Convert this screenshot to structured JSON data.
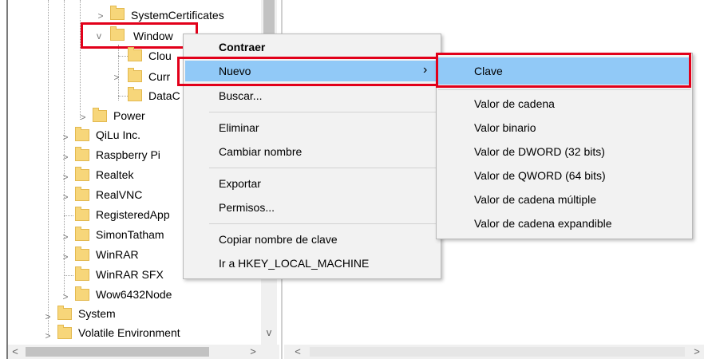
{
  "tree": {
    "items": [
      {
        "label": "SystemCertificates"
      },
      {
        "label": "Window"
      },
      {
        "label": "Clou"
      },
      {
        "label": "Curr"
      },
      {
        "label": "DataC"
      },
      {
        "label": "Power"
      },
      {
        "label": "QiLu Inc."
      },
      {
        "label": "Raspberry Pi"
      },
      {
        "label": "Realtek"
      },
      {
        "label": "RealVNC"
      },
      {
        "label": "RegisteredApp"
      },
      {
        "label": "SimonTatham"
      },
      {
        "label": "WinRAR"
      },
      {
        "label": "WinRAR SFX"
      },
      {
        "label": "Wow6432Node"
      },
      {
        "label": "System"
      },
      {
        "label": "Volatile Environment"
      }
    ]
  },
  "context_menu": {
    "items": [
      {
        "label": "Contraer"
      },
      {
        "label": "Nuevo"
      },
      {
        "label": "Buscar..."
      },
      {
        "label": "Eliminar"
      },
      {
        "label": "Cambiar nombre"
      },
      {
        "label": "Exportar"
      },
      {
        "label": "Permisos..."
      },
      {
        "label": "Copiar nombre de clave"
      },
      {
        "label": "Ir a HKEY_LOCAL_MACHINE"
      }
    ],
    "submenu_arrow": "›"
  },
  "submenu": {
    "items": [
      {
        "label": "Clave"
      },
      {
        "label": "Valor de cadena"
      },
      {
        "label": "Valor binario"
      },
      {
        "label": "Valor de DWORD (32 bits)"
      },
      {
        "label": "Valor de QWORD (64 bits)"
      },
      {
        "label": "Valor de cadena múltiple"
      },
      {
        "label": "Valor de cadena expandible"
      }
    ]
  },
  "scroll": {
    "left_arrow": "<",
    "right_arrow": ">",
    "down_arrow": "v"
  },
  "colors": {
    "highlight": "#91c9f7",
    "annotation_red": "#e2001a",
    "folder": "#f7d67a"
  }
}
